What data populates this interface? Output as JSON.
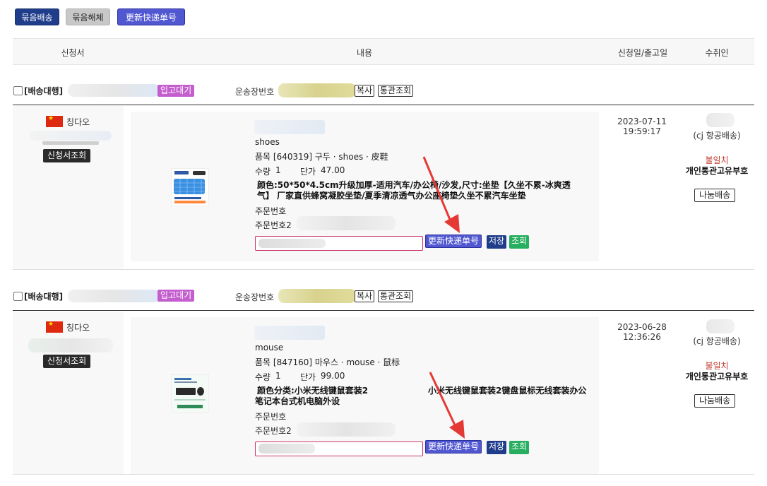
{
  "toolbar": {
    "bundle_label": "묶음배송",
    "unbundle_label": "묶음해체",
    "update_tracking_label": "更新快递单号"
  },
  "table_header": {
    "col_application": "신청서",
    "col_content": "내용",
    "col_date": "신청일/출고일",
    "col_receiver": "수취인"
  },
  "orders": [
    {
      "service_label": "[배송대행]",
      "status_badge": "입고대기",
      "tracking_label": "운송장번호",
      "copy_label": "복사",
      "customs_label": "통관조회",
      "city": "칭다오",
      "view_application_label": "신청서조회",
      "product_name": "shoes",
      "item_line": "품목  [640319] 구두 · shoes · 皮鞋",
      "qty_label": "수량",
      "qty": "1",
      "price_label": "단가",
      "price": "47.00",
      "option_text": "颜色:50*50*4.5cm升级加厚-适用汽车/办公椅/沙发,尺寸:坐垫【久坐不累-冰爽透气】 厂家直供蜂窝凝胶坐垫/夏季清凉透气办公座椅垫久坐不累汽车坐垫",
      "order_no_label": "주문번호",
      "order_no2_label": "주문번호2",
      "update_btn": "更新快递单号",
      "save_btn": "저장",
      "query_btn": "조회",
      "date": "2023-07-11",
      "time": "19:59:17",
      "shipping_method": "(cj 항공배송)",
      "mismatch_label": "불일치",
      "customs_id_label": "개인통관고유부호",
      "split_btn": "나눔배송"
    },
    {
      "service_label": "[배송대행]",
      "status_badge": "입고대기",
      "tracking_label": "운송장번호",
      "copy_label": "복사",
      "customs_label": "통관조회",
      "city": "칭다오",
      "view_application_label": "신청서조회",
      "product_name": "mouse",
      "item_line": "품목  [847160] 마우스 · mouse · 鼠标",
      "qty_label": "수량",
      "qty": "1",
      "price_label": "단가",
      "price": "99.00",
      "option_text_1": "颜色分类:小米无线键鼠套装2",
      "option_text_2": "小米无线键鼠套装2键盘鼠标无线套装办公",
      "option_text_3": "笔记本台式机电脑外设",
      "order_no_label": "주문번호",
      "order_no2_label": "주문번호2",
      "update_btn": "更新快递单号",
      "save_btn": "저장",
      "query_btn": "조회",
      "date": "2023-06-28",
      "time": "12:36:26",
      "shipping_method": "(cj 항공배송)",
      "mismatch_label": "불일치",
      "customs_id_label": "개인통관고유부호",
      "split_btn": "나눔배송"
    }
  ],
  "colors": {
    "navy": "#1f3d8a",
    "purple": "#5057d0",
    "badge_purple": "#c45ecf",
    "green": "#27ae60",
    "red_text": "#c0392b",
    "arrow_red": "#e53935"
  }
}
